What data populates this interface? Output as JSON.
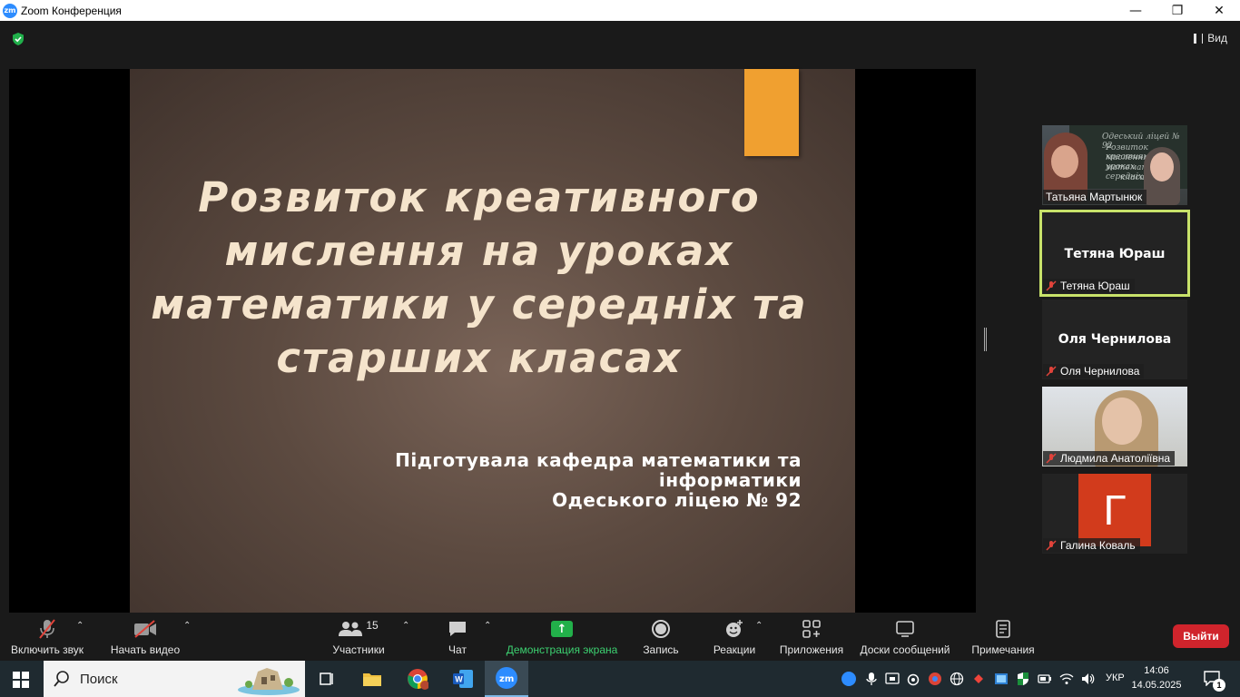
{
  "window": {
    "title": "Zoom Конференция",
    "app_icon_text": "zm"
  },
  "view_button": {
    "label": "Вид"
  },
  "slide": {
    "title_lines": [
      "Розвиток креативного",
      "мислення на уроках",
      "математики у середніх та",
      "старших класах"
    ],
    "subtitle_lines": [
      "Підготувала кафедра математики та",
      "інформатики",
      "Одеського ліцею № 92"
    ],
    "accent_color": "#f0a030"
  },
  "participants": [
    {
      "name": "Татьяна Мартынюк",
      "video": true,
      "muted": false,
      "board_text": [
        "Одеський ліцей № 92",
        "Розвиток креативного",
        "мислення на уроках",
        "математики у середніх",
        "класах"
      ]
    },
    {
      "name": "Тетяна Юраш",
      "display_name": "Тетяна Юраш",
      "video": false,
      "muted": true,
      "active_speaker": true
    },
    {
      "name": "Оля Чернилова",
      "display_name": "Оля Чернилова",
      "video": false,
      "muted": true
    },
    {
      "name": "Людмила Анатоліївна",
      "video": true,
      "muted": true
    },
    {
      "name": "Галина Коваль",
      "avatar_letter": "Г",
      "avatar_color": "#d23b1c",
      "video": false,
      "muted": true
    }
  ],
  "toolbar": {
    "unmute_label": "Включить звук",
    "video_label": "Начать видео",
    "participants_label": "Участники",
    "participants_count": "15",
    "chat_label": "Чат",
    "share_label": "Демонстрация экрана",
    "record_label": "Запись",
    "reactions_label": "Реакции",
    "apps_label": "Приложения",
    "boards_label": "Доски сообщений",
    "notes_label": "Примечания",
    "leave_label": "Выйти"
  },
  "taskbar": {
    "search_label": "Поиск",
    "language": "УКР",
    "time": "14:06",
    "date": "14.05.2025",
    "notification_count": "1"
  }
}
